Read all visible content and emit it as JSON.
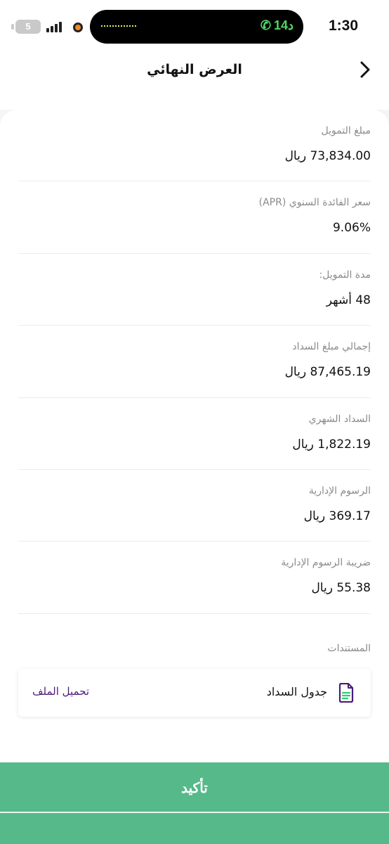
{
  "status_bar": {
    "time": "1:30",
    "call_duration": "14د",
    "battery_level": "5"
  },
  "header": {
    "title": "العرض النهائي"
  },
  "details": [
    {
      "label": "مبلغ التمويل",
      "value": "73,834.00 ريال"
    },
    {
      "label": "سعر الفائدة السنوي (APR)",
      "value": "9.06%"
    },
    {
      "label": "مدة التمويل:",
      "value": "48 أشهر"
    },
    {
      "label": "إجمالي مبلغ السداد",
      "value": "87,465.19 ريال"
    },
    {
      "label": "السداد الشهري",
      "value": "1,822.19 ريال"
    },
    {
      "label": "الرسوم الإدارية",
      "value": "369.17 ريال"
    },
    {
      "label": "ضريبة الرسوم الإدارية",
      "value": "55.38 ريال"
    }
  ],
  "documents": {
    "section_label": "المستندات",
    "items": [
      {
        "name": "جدول السداد",
        "action": "تحميل الملف",
        "icon": "document-icon"
      }
    ]
  },
  "confirm": {
    "label": "تأكيد"
  },
  "colors": {
    "primary_button": "#56b98a",
    "link": "#4b1a7a",
    "doc_icon": "#4b1a7a",
    "doc_icon_accent": "#2ecc71",
    "call_green": "#4cd964"
  }
}
